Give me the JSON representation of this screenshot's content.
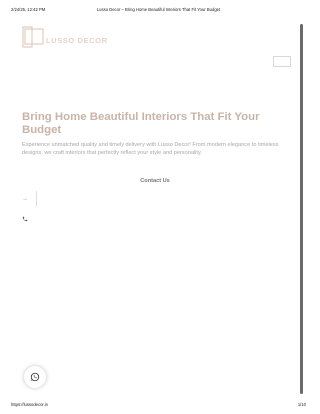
{
  "print_header": {
    "datetime": "2/24/25, 12:42 PM",
    "doc_title": "Lusso Decor – Bring Home Beautiful Interiors That Fit Your Budget"
  },
  "logo": {
    "text": "LUSSO DECOR"
  },
  "hero": {
    "title": "Bring Home Beautiful Interiors That Fit Your Budget",
    "description": "Experience unmatched quality and timely delivery with Lusso Decor! From modern elegance to timeless designs, we craft interiors that perfectly reflect your style and personality.",
    "contact_label": "Contact Us"
  },
  "icons": {
    "arrow": "arrow-right-icon",
    "phone": "phone-icon",
    "whatsapp": "whatsapp-icon"
  },
  "print_footer": {
    "url": "https://lussodecor.in",
    "page": "1/10"
  }
}
